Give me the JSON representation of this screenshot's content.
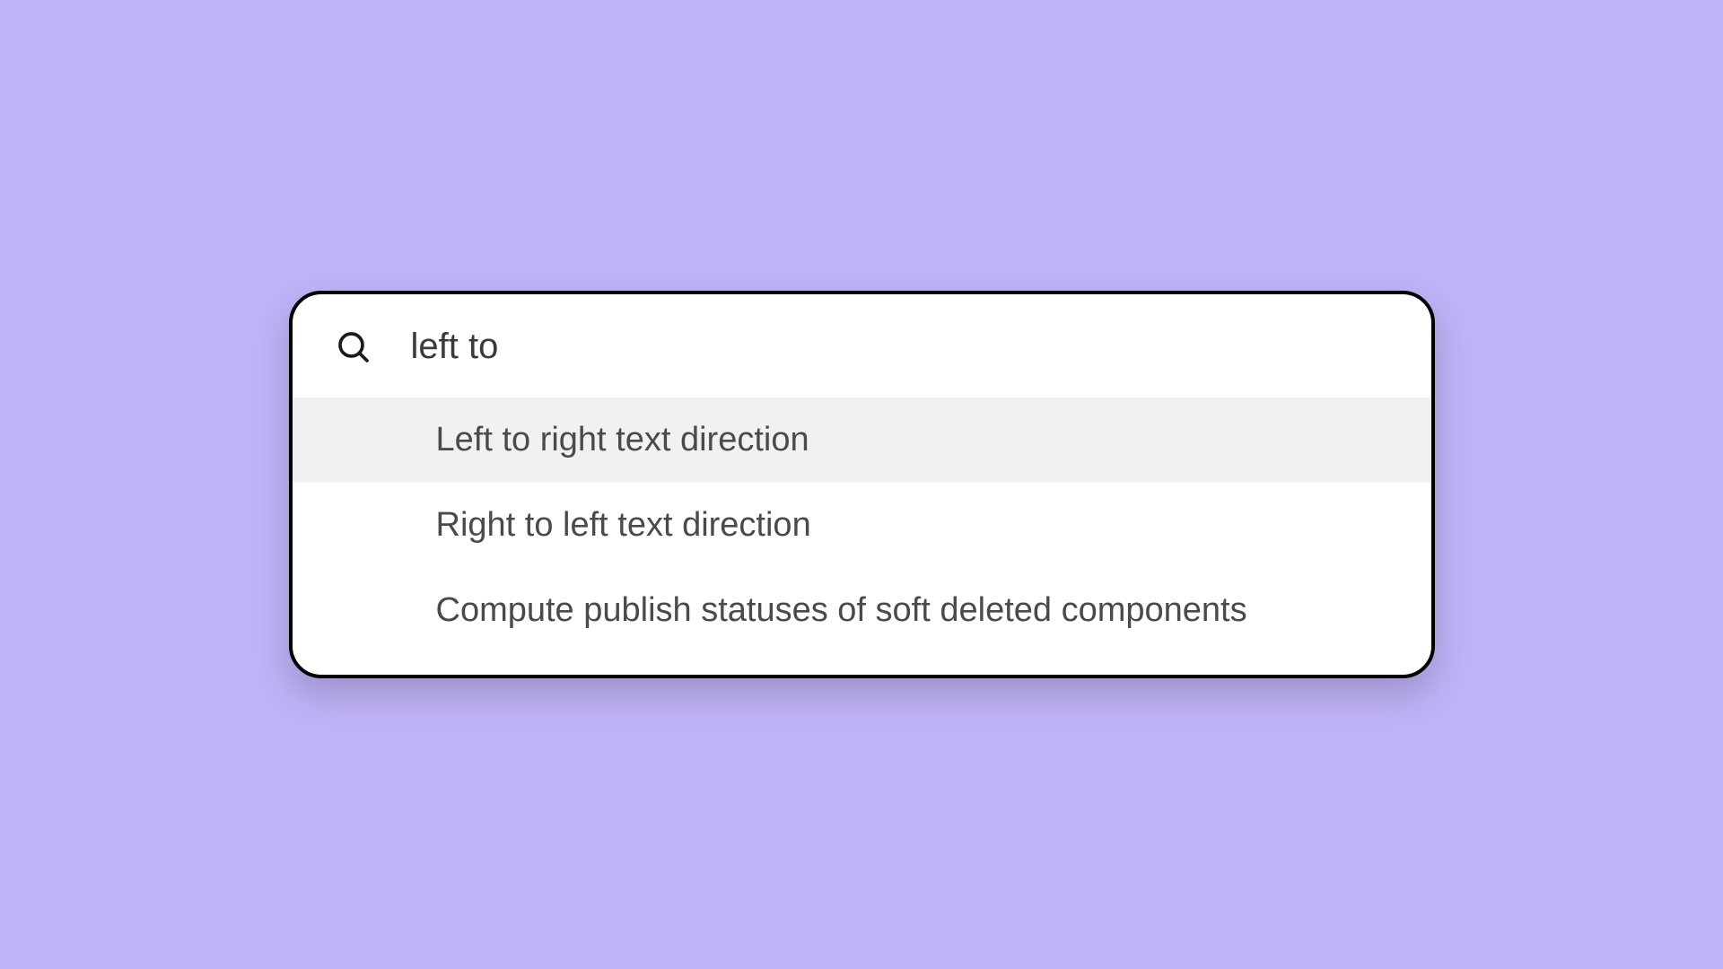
{
  "search": {
    "query": "left to",
    "placeholder": ""
  },
  "results": [
    {
      "label": "Left to right text direction",
      "highlighted": true
    },
    {
      "label": "Right to left text direction",
      "highlighted": false
    },
    {
      "label": "Compute publish statuses of soft deleted components",
      "highlighted": false
    }
  ]
}
